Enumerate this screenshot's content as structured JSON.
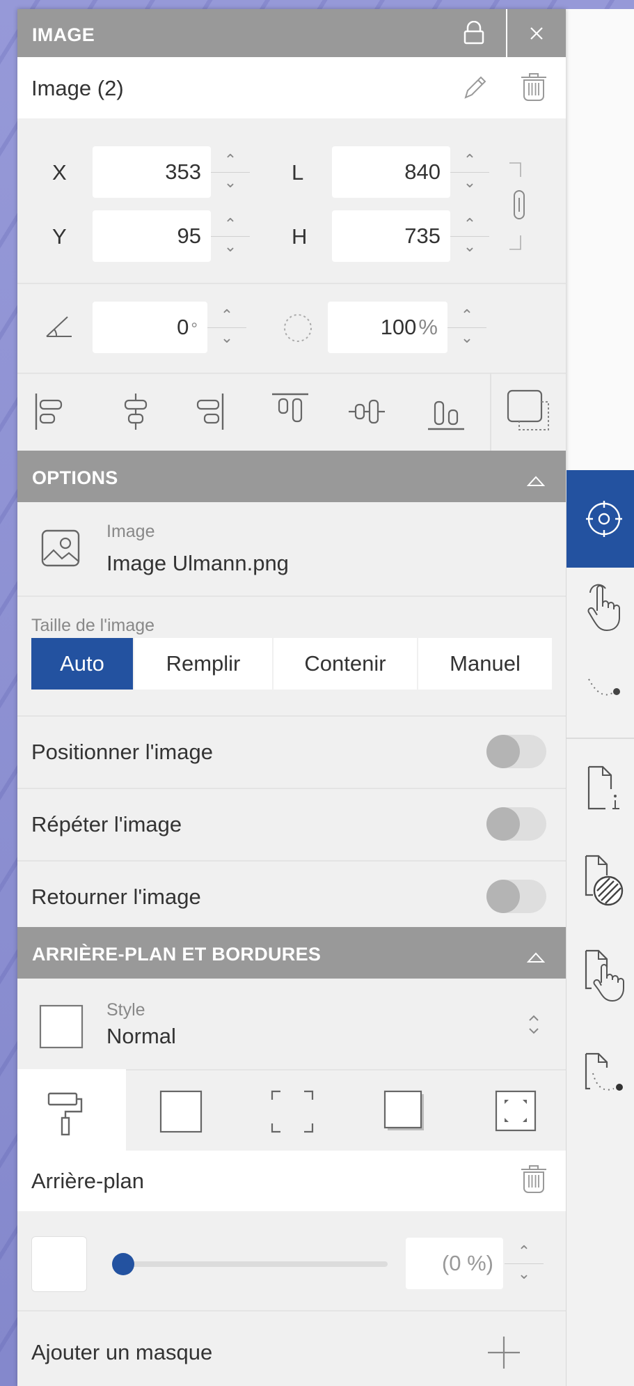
{
  "header": {
    "title": "IMAGE"
  },
  "object": {
    "name": "Image (2)"
  },
  "geometry": {
    "x_label": "X",
    "x_value": "353",
    "y_label": "Y",
    "y_value": "95",
    "w_label": "L",
    "w_value": "840",
    "h_label": "H",
    "h_value": "735",
    "rotation_value": "0",
    "rotation_unit": "°",
    "opacity_value": "100",
    "opacity_unit": "%"
  },
  "options": {
    "section_title": "OPTIONS",
    "image_caption": "Image",
    "image_file": "Image Ulmann.png",
    "size_label": "Taille de l'image",
    "size_modes": [
      "Auto",
      "Remplir",
      "Contenir",
      "Manuel"
    ],
    "size_selected": "Auto",
    "position_label": "Positionner l'image",
    "repeat_label": "Répéter l'image",
    "flip_label": "Retourner l'image"
  },
  "background": {
    "section_title": "ARRIÈRE-PLAN ET BORDURES",
    "style_caption": "Style",
    "style_value": "Normal",
    "bg_label": "Arrière-plan",
    "bg_percent": "(0 %)",
    "bg_fill_fraction": 0.0,
    "mask_label": "Ajouter un masque"
  },
  "colors": {
    "accent": "#2352a0",
    "header": "#999999"
  }
}
